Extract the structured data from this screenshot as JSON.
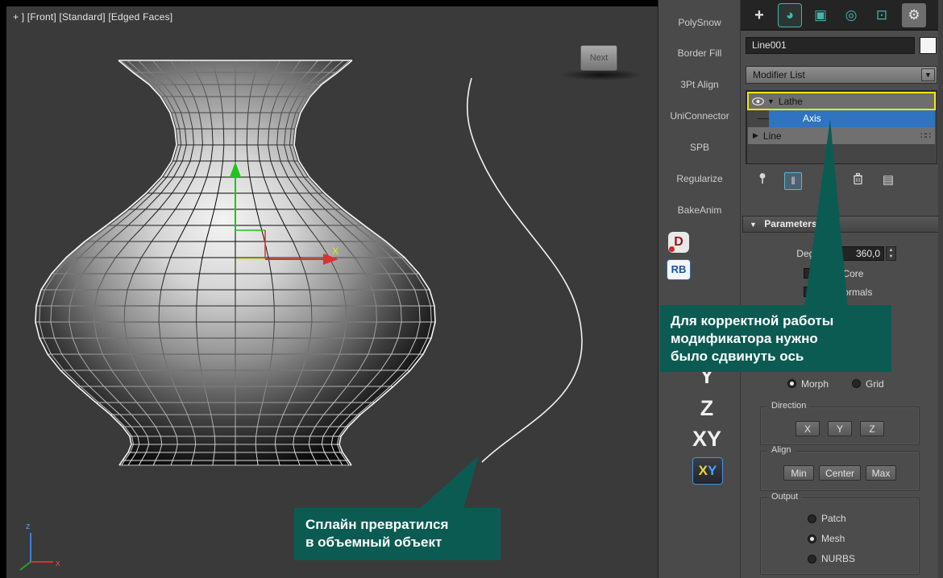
{
  "viewport": {
    "label": "+ ] [Front] [Standard] [Edged Faces]",
    "next_button": "Next",
    "gizmo_x_label": "X",
    "tripod_x": "x",
    "tripod_z": "z"
  },
  "modifier_toolbar": {
    "items": [
      "PolySnow",
      "Border Fill",
      "3Pt Align",
      "UniConnector",
      "SPB",
      "Regularize",
      "BakeAnim"
    ],
    "d_icon": "D",
    "rb_icon": "RB"
  },
  "axis_constraints": {
    "y": "Y",
    "z": "Z",
    "xy": "XY",
    "icon_x": "X",
    "icon_y": "Y"
  },
  "command_panel": {
    "tabs": {
      "create": "+",
      "modify": "◕",
      "hierarchy": "▣",
      "motion": "◎",
      "display": "⊡",
      "utilities": "⚙"
    },
    "object_name": "Line001",
    "modifier_list": "Modifier List",
    "stack": {
      "lathe": "Lathe",
      "axis": "Axis",
      "line": "Line"
    },
    "stack_tools": {
      "show_end": "‖",
      "configure": "▤"
    },
    "parameters": {
      "title": "Parameters",
      "degrees_label": "Degrees:",
      "degrees_value": "360,0",
      "weld_core": "Weld Core",
      "flip_normals": "Flip Normals",
      "morph": "Morph",
      "grid": "Grid",
      "direction": "Direction",
      "dir_x": "X",
      "dir_y": "Y",
      "dir_z": "Z",
      "align": "Align",
      "align_min": "Min",
      "align_center": "Center",
      "align_max": "Max",
      "output": "Output",
      "out_patch": "Patch",
      "out_mesh": "Mesh",
      "out_nurbs": "NURBS"
    }
  },
  "glyphs": {
    "down_arrow": "▼",
    "right_arrow": "▶",
    "spin_up": "▲",
    "spin_down": "▼",
    "dots": "∷∷",
    "check": "✓"
  },
  "callouts": {
    "axis_note": {
      "line1": "Для корректной работы",
      "line2": "модификатора нужно",
      "line3": "было сдвинуть ось"
    },
    "spline_note": {
      "line1": "Сплайн превратился",
      "line2": "в объемный объект"
    }
  },
  "colors": {
    "callout_teal": "#0c5b53",
    "selection_blue": "#2f74c0",
    "highlight_yellow": "#efe70c",
    "icon_teal": "#3fb8ac"
  }
}
